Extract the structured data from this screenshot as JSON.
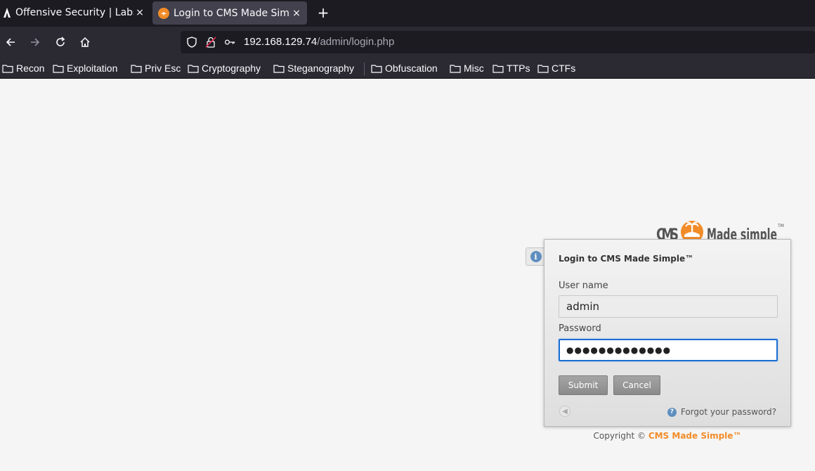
{
  "browser": {
    "tabs": [
      {
        "title": "Offensive Security | Labs |",
        "favicon": "offsec-icon",
        "active": false
      },
      {
        "title": "Login to CMS Made Simpl",
        "favicon": "cms-icon",
        "active": true
      }
    ],
    "new_tab_label": "+",
    "close_label": "×",
    "url": {
      "host": "192.168.129.74",
      "path": "/admin/login.php"
    },
    "bookmarks": [
      "Recon",
      "Exploitation",
      "Priv Esc",
      "Cryptography",
      "Steganography",
      "Obfuscation",
      "Misc",
      "TTPs",
      "CTFs"
    ]
  },
  "page": {
    "logo_alt": "CMS Made Simple",
    "login": {
      "title": "Login to CMS Made Simple™",
      "username_label": "User name",
      "username_value": "admin",
      "password_label": "Password",
      "password_value": "●●●●●●●●●●●●●",
      "submit_label": "Submit",
      "cancel_label": "Cancel",
      "forgot_label": "Forgot your password?"
    },
    "copyright_prefix": "Copyright © ",
    "copyright_brand": "CMS Made Simple™"
  },
  "colors": {
    "brand_orange": "#f28c28",
    "focus_blue": "#1a6fd3"
  }
}
